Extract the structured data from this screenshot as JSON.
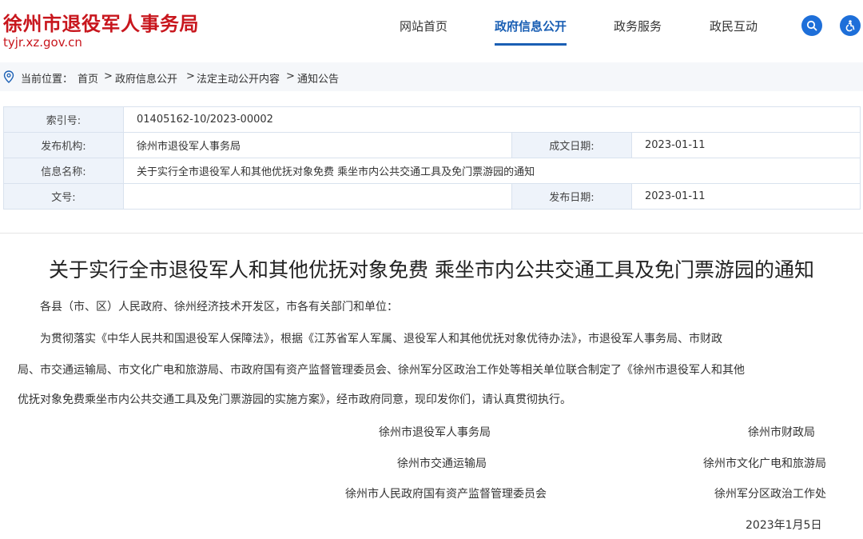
{
  "header": {
    "site_title": "徐州市退役军人事务局",
    "site_url": "tyjr.xz.gov.cn",
    "nav": [
      {
        "label": "网站首页"
      },
      {
        "label": "政府信息公开"
      },
      {
        "label": "政务服务"
      },
      {
        "label": "政民互动"
      }
    ],
    "active_nav": "政府信息公开",
    "icons": [
      "search-icon",
      "accessibility-icon"
    ],
    "colors": {
      "brand_red": "#c8161d",
      "accent_blue": "#1a5fb4"
    }
  },
  "breadcrumb": {
    "prefix": "当前位置：",
    "items": [
      "首页",
      "政府信息公开",
      "法定主动公开内容",
      "通知公告"
    ],
    "separator": ">"
  },
  "info_table": {
    "index_label": "索引号:",
    "index_value": "01405162-10/2023-00002",
    "publisher_label": "发布机构:",
    "publisher_value": "徐州市退役军人事务局",
    "created_label": "成文日期:",
    "created_value": "2023-01-11",
    "name_label": "信息名称:",
    "name_value": "关于实行全市退役军人和其他优抚对象免费 乘坐市内公共交通工具及免门票游园的通知",
    "docno_label": "文号:",
    "docno_value": "",
    "published_label": "发布日期:",
    "published_value": "2023-01-11"
  },
  "document": {
    "title": "关于实行全市退役军人和其他优抚对象免费 乘坐市内公共交通工具及免门票游园的通知",
    "salutation": "各县（市、区）人民政府、徐州经济技术开发区，市各有关部门和单位：",
    "body_line1": "为贯彻落实《中华人民共和国退役军人保障法》，根据《江苏省军人军属、退役军人和其他优抚对象优待办法》，市退役军人事务局、市财政",
    "body_line2": "局、市交通运输局、市文化广电和旅游局、市政府国有资产监督管理委员会、徐州军分区政治工作处等相关单位联合制定了《徐州市退役军人和其他",
    "body_line3": "优抚对象免费乘坐市内公共交通工具及免门票游园的实施方案》，经市政府同意，现印发你们，请认真贯彻执行。",
    "signatories": [
      "徐州市退役军人事务局",
      "徐州市财政局",
      "徐州市交通运输局",
      "徐州市文化广电和旅游局",
      "徐州市人民政府国有资产监督管理委员会",
      "徐州军分区政治工作处"
    ],
    "date": "2023年1月5日"
  }
}
